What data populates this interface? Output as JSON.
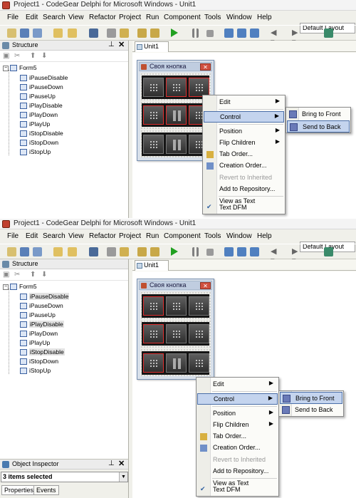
{
  "window": {
    "title": "Project1 - CodeGear Delphi for Microsoft Windows - Unit1",
    "layout": "Default Layout"
  },
  "menu": [
    "File",
    "Edit",
    "Search",
    "View",
    "Refactor",
    "Project",
    "Run",
    "Component",
    "Tools",
    "Window",
    "Help"
  ],
  "structure": {
    "title": "Structure",
    "root": "Form5",
    "items": [
      "iPauseDisable",
      "iPauseDown",
      "iPauseUp",
      "iPlayDisable",
      "iPlayDown",
      "iPlayUp",
      "iStopDisable",
      "iStopDown",
      "iStopUp"
    ]
  },
  "editor": {
    "tab": "Unit1",
    "form_caption": "Своя кнопка"
  },
  "context_menu": {
    "items": [
      "Edit",
      "Control",
      "Position",
      "Flip Children",
      "Tab Order...",
      "Creation Order...",
      "Revert to Inherited",
      "Add to Repository...",
      "View as Text",
      "Text DFM"
    ],
    "submenu": [
      "Bring to Front",
      "Send to Back"
    ]
  },
  "object_inspector": {
    "title": "Object Inspector",
    "selection": "3 items selected",
    "tabs": [
      "Properties",
      "Events"
    ]
  },
  "colors": {
    "menu_highlight": "#c4d4ee",
    "highlight_border": "#4a6ea8",
    "selection_outline": "#e03030"
  }
}
